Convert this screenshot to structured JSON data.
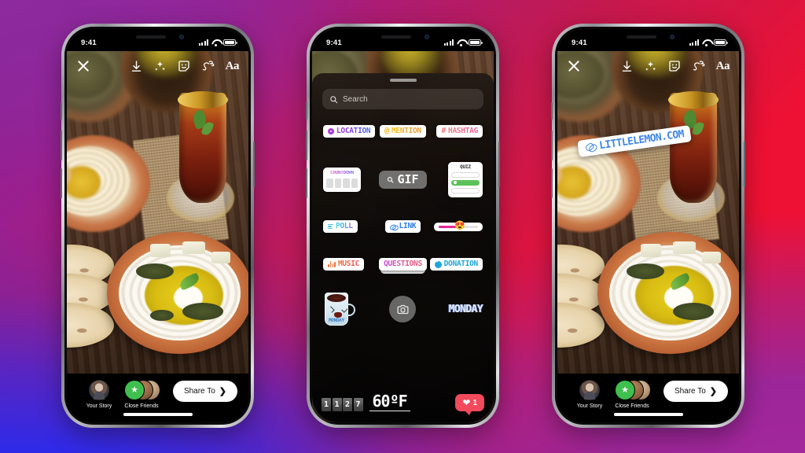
{
  "background": {
    "gradient_colors": [
      "#8a2196",
      "#ee1133",
      "#2a2ef0",
      "#a3279c"
    ],
    "description": "purple-to-red-to-blue gradient"
  },
  "status_bar": {
    "time": "9:41",
    "signal_icon": "cellular-bars-icon",
    "wifi_icon": "wifi-icon",
    "battery_icon": "battery-icon"
  },
  "story_toolbar": {
    "close_label": "close-icon",
    "tools": [
      {
        "name": "download-icon",
        "label": "Save"
      },
      {
        "name": "effects-sparkle-icon",
        "label": "Effects"
      },
      {
        "name": "sticker-smiley-icon",
        "label": "Stickers"
      },
      {
        "name": "draw-squiggle-icon",
        "label": "Draw"
      },
      {
        "name": "text-aa-icon",
        "label": "Aa"
      }
    ],
    "text_tool_label": "Aa"
  },
  "story_footer": {
    "your_story_label": "Your Story",
    "close_friends_label": "Close Friends",
    "share_button_label": "Share To",
    "share_chevron": "❯"
  },
  "sticker_tray": {
    "search": {
      "placeholder": "Search",
      "icon": "search-icon"
    },
    "row_1": [
      {
        "id": "location",
        "label": "LOCATION",
        "icon": "location-pin-icon",
        "color": "#8a3fe0"
      },
      {
        "id": "mention",
        "label": "MENTION",
        "icon": "at-sign-icon",
        "color": "#f3b41c"
      },
      {
        "id": "hashtag",
        "label": "HASHTAG",
        "icon": "hash-icon",
        "color": "#f47a7a"
      }
    ],
    "row_2": {
      "countdown": {
        "label": "COUNTDOWN",
        "digit_count": 4
      },
      "gif": {
        "label": "GIF",
        "icon": "search-icon"
      },
      "quiz": {
        "label": "QUIZ",
        "options": 3,
        "selected_index": 1,
        "selected_color": "#5dc15a"
      }
    },
    "row_3": [
      {
        "id": "poll",
        "label": "POLL",
        "icon": "poll-bars-icon",
        "color": "#45c3e0"
      },
      {
        "id": "link",
        "label": "LINK",
        "icon": "link-chain-icon",
        "color": "#2f7fe8"
      },
      {
        "id": "slider",
        "label": "",
        "icon": "emoji-slider-icon",
        "emoji": "😍",
        "fill_color": "#e0209a"
      }
    ],
    "row_4": [
      {
        "id": "music",
        "label": "MUSIC",
        "icon": "music-bars-icon",
        "color": "#f0703a"
      },
      {
        "id": "questions",
        "label": "QUESTIONS",
        "icon": "questions-icon",
        "color": "#e0568f"
      },
      {
        "id": "donation",
        "label": "DONATION",
        "icon": "donation-heart-icon",
        "color": "#1fa7d8"
      }
    ],
    "row_5": {
      "mug_sticker": {
        "label": "MONDAY",
        "icon": "monday-mug-icon"
      },
      "camera": {
        "icon": "camera-icon"
      },
      "monday_text": "MONDAY"
    },
    "bottom_row": {
      "clock_digits": [
        "1",
        "1",
        "2",
        "7"
      ],
      "temperature": "60ºF",
      "like_badge": {
        "icon": "heart-icon",
        "count": "1",
        "color": "#f24a5c"
      }
    }
  },
  "link_sticker": {
    "url_text": "LITTLELEMON.COM",
    "icon": "link-chain-icon",
    "color": "#3f86e8"
  },
  "phones": [
    {
      "id": "phone-1",
      "state": "story-editor"
    },
    {
      "id": "phone-2",
      "state": "sticker-tray-open"
    },
    {
      "id": "phone-3",
      "state": "link-sticker-placed"
    }
  ]
}
